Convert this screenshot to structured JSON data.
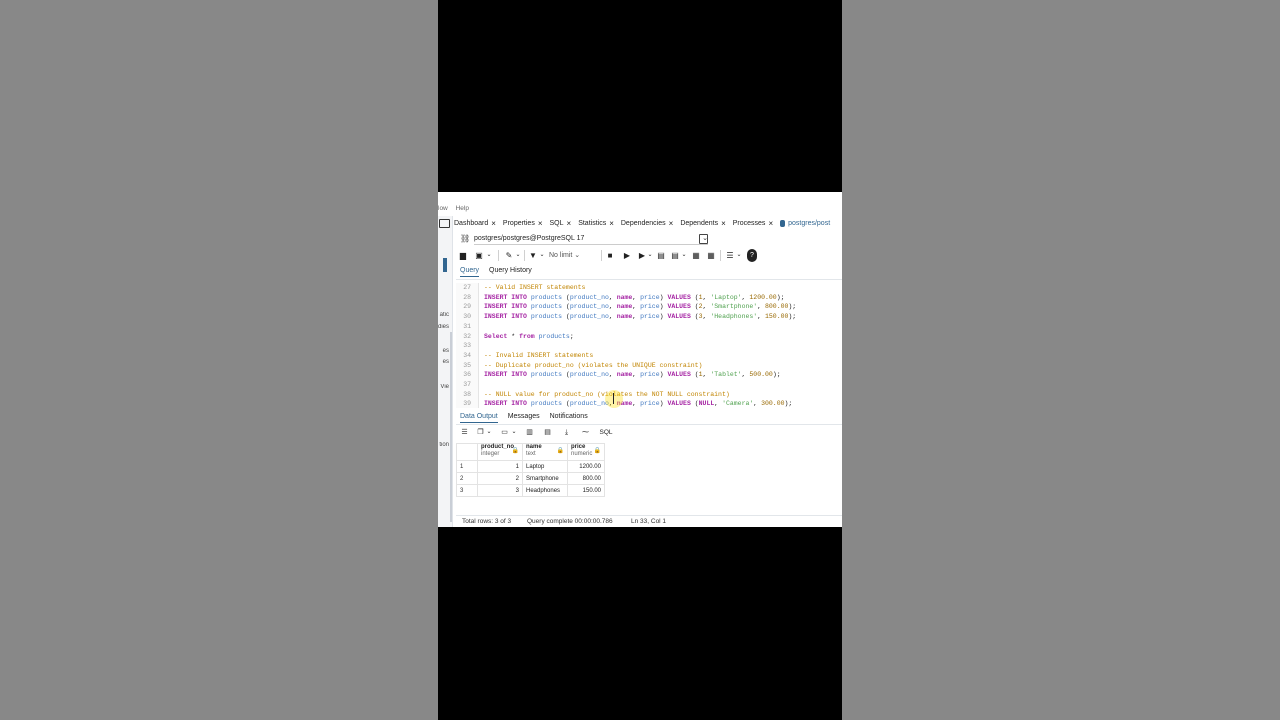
{
  "menubar": {
    "left_fragment": "low",
    "help": "Help"
  },
  "left_fragments": [
    "atic",
    "dies",
    "es",
    "es",
    "Vie",
    "tion"
  ],
  "tabs": [
    {
      "label": "Dashboard"
    },
    {
      "label": "Properties"
    },
    {
      "label": "SQL"
    },
    {
      "label": "Statistics"
    },
    {
      "label": "Dependencies"
    },
    {
      "label": "Dependents"
    },
    {
      "label": "Processes"
    },
    {
      "label": "postgres/post"
    }
  ],
  "connection": {
    "value": "postgres/postgres@PostgreSQL 17"
  },
  "toolbar": {
    "limit": "No limit"
  },
  "query_tabs": {
    "query": "Query",
    "history": "Query History"
  },
  "editor_lines": [
    {
      "n": "27",
      "html": "<span class='cmt'>-- Valid INSERT statements</span>"
    },
    {
      "n": "28",
      "html": "<span class='kw'>INSERT INTO</span> <span class='id'>products</span> (<span class='id'>product_no</span>, <span class='kw'>name</span>, <span class='id'>price</span>) <span class='kw'>VALUES</span> (<span class='num'>1</span>, <span class='str'>'Laptop'</span>, <span class='num'>1200.00</span>);"
    },
    {
      "n": "29",
      "html": "<span class='kw'>INSERT INTO</span> <span class='id'>products</span> (<span class='id'>product_no</span>, <span class='kw'>name</span>, <span class='id'>price</span>) <span class='kw'>VALUES</span> (<span class='num'>2</span>, <span class='str'>'Smartphone'</span>, <span class='num'>800.00</span>);"
    },
    {
      "n": "30",
      "html": "<span class='kw'>INSERT INTO</span> <span class='id'>products</span> (<span class='id'>product_no</span>, <span class='kw'>name</span>, <span class='id'>price</span>) <span class='kw'>VALUES</span> (<span class='num'>3</span>, <span class='str'>'Headphones'</span>, <span class='num'>150.00</span>);"
    },
    {
      "n": "31",
      "html": ""
    },
    {
      "n": "32",
      "html": "<span class='kw'>Select</span> * <span class='kw'>from</span> <span class='id'>products</span>;"
    },
    {
      "n": "33",
      "html": ""
    },
    {
      "n": "34",
      "html": "<span class='cmt'>-- Invalid INSERT statements</span>"
    },
    {
      "n": "35",
      "html": "<span class='cmt'>-- Duplicate product_no (violates the UNIQUE constraint)</span>"
    },
    {
      "n": "36",
      "html": "<span class='kw'>INSERT INTO</span> <span class='id'>products</span> (<span class='id'>product_no</span>, <span class='kw'>name</span>, <span class='id'>price</span>) <span class='kw'>VALUES</span> (<span class='num'>1</span>, <span class='str'>'Tablet'</span>, <span class='num'>500.00</span>);"
    },
    {
      "n": "37",
      "html": ""
    },
    {
      "n": "38",
      "html": "<span class='cmt'>-- NULL value for product_no (violates the NOT NULL constraint)</span>"
    },
    {
      "n": "39",
      "html": "<span class='kw'>INSERT INTO</span> <span class='id'>products</span> (<span class='id'>product_no</span>, <span class='kw'>name</span>, <span class='id'>price</span>) <span class='kw'>VALUES</span> (<span class='kw'>NULL</span>, <span class='str'>'Camera'</span>, <span class='num'>300.00</span>);"
    }
  ],
  "output_tabs": {
    "data": "Data Output",
    "messages": "Messages",
    "notifications": "Notifications"
  },
  "output_toolbar": {
    "sql": "SQL"
  },
  "grid": {
    "columns": [
      {
        "name": "product_no",
        "type": "integer"
      },
      {
        "name": "name",
        "type": "text"
      },
      {
        "name": "price",
        "type": "numeric"
      }
    ],
    "rows": [
      {
        "n": "1",
        "product_no": "1",
        "name": "Laptop",
        "price": "1200.00"
      },
      {
        "n": "2",
        "product_no": "2",
        "name": "Smartphone",
        "price": "800.00"
      },
      {
        "n": "3",
        "product_no": "3",
        "name": "Headphones",
        "price": "150.00"
      }
    ]
  },
  "status": {
    "rows": "Total rows: 3 of 3",
    "query": "Query complete 00:00:00.786",
    "position": "Ln 33, Col 1"
  },
  "colors": {
    "accent": "#326690",
    "keyword": "#a626a4",
    "comment": "#c18401",
    "identifier": "#4078c0",
    "string": "#50a14f"
  }
}
